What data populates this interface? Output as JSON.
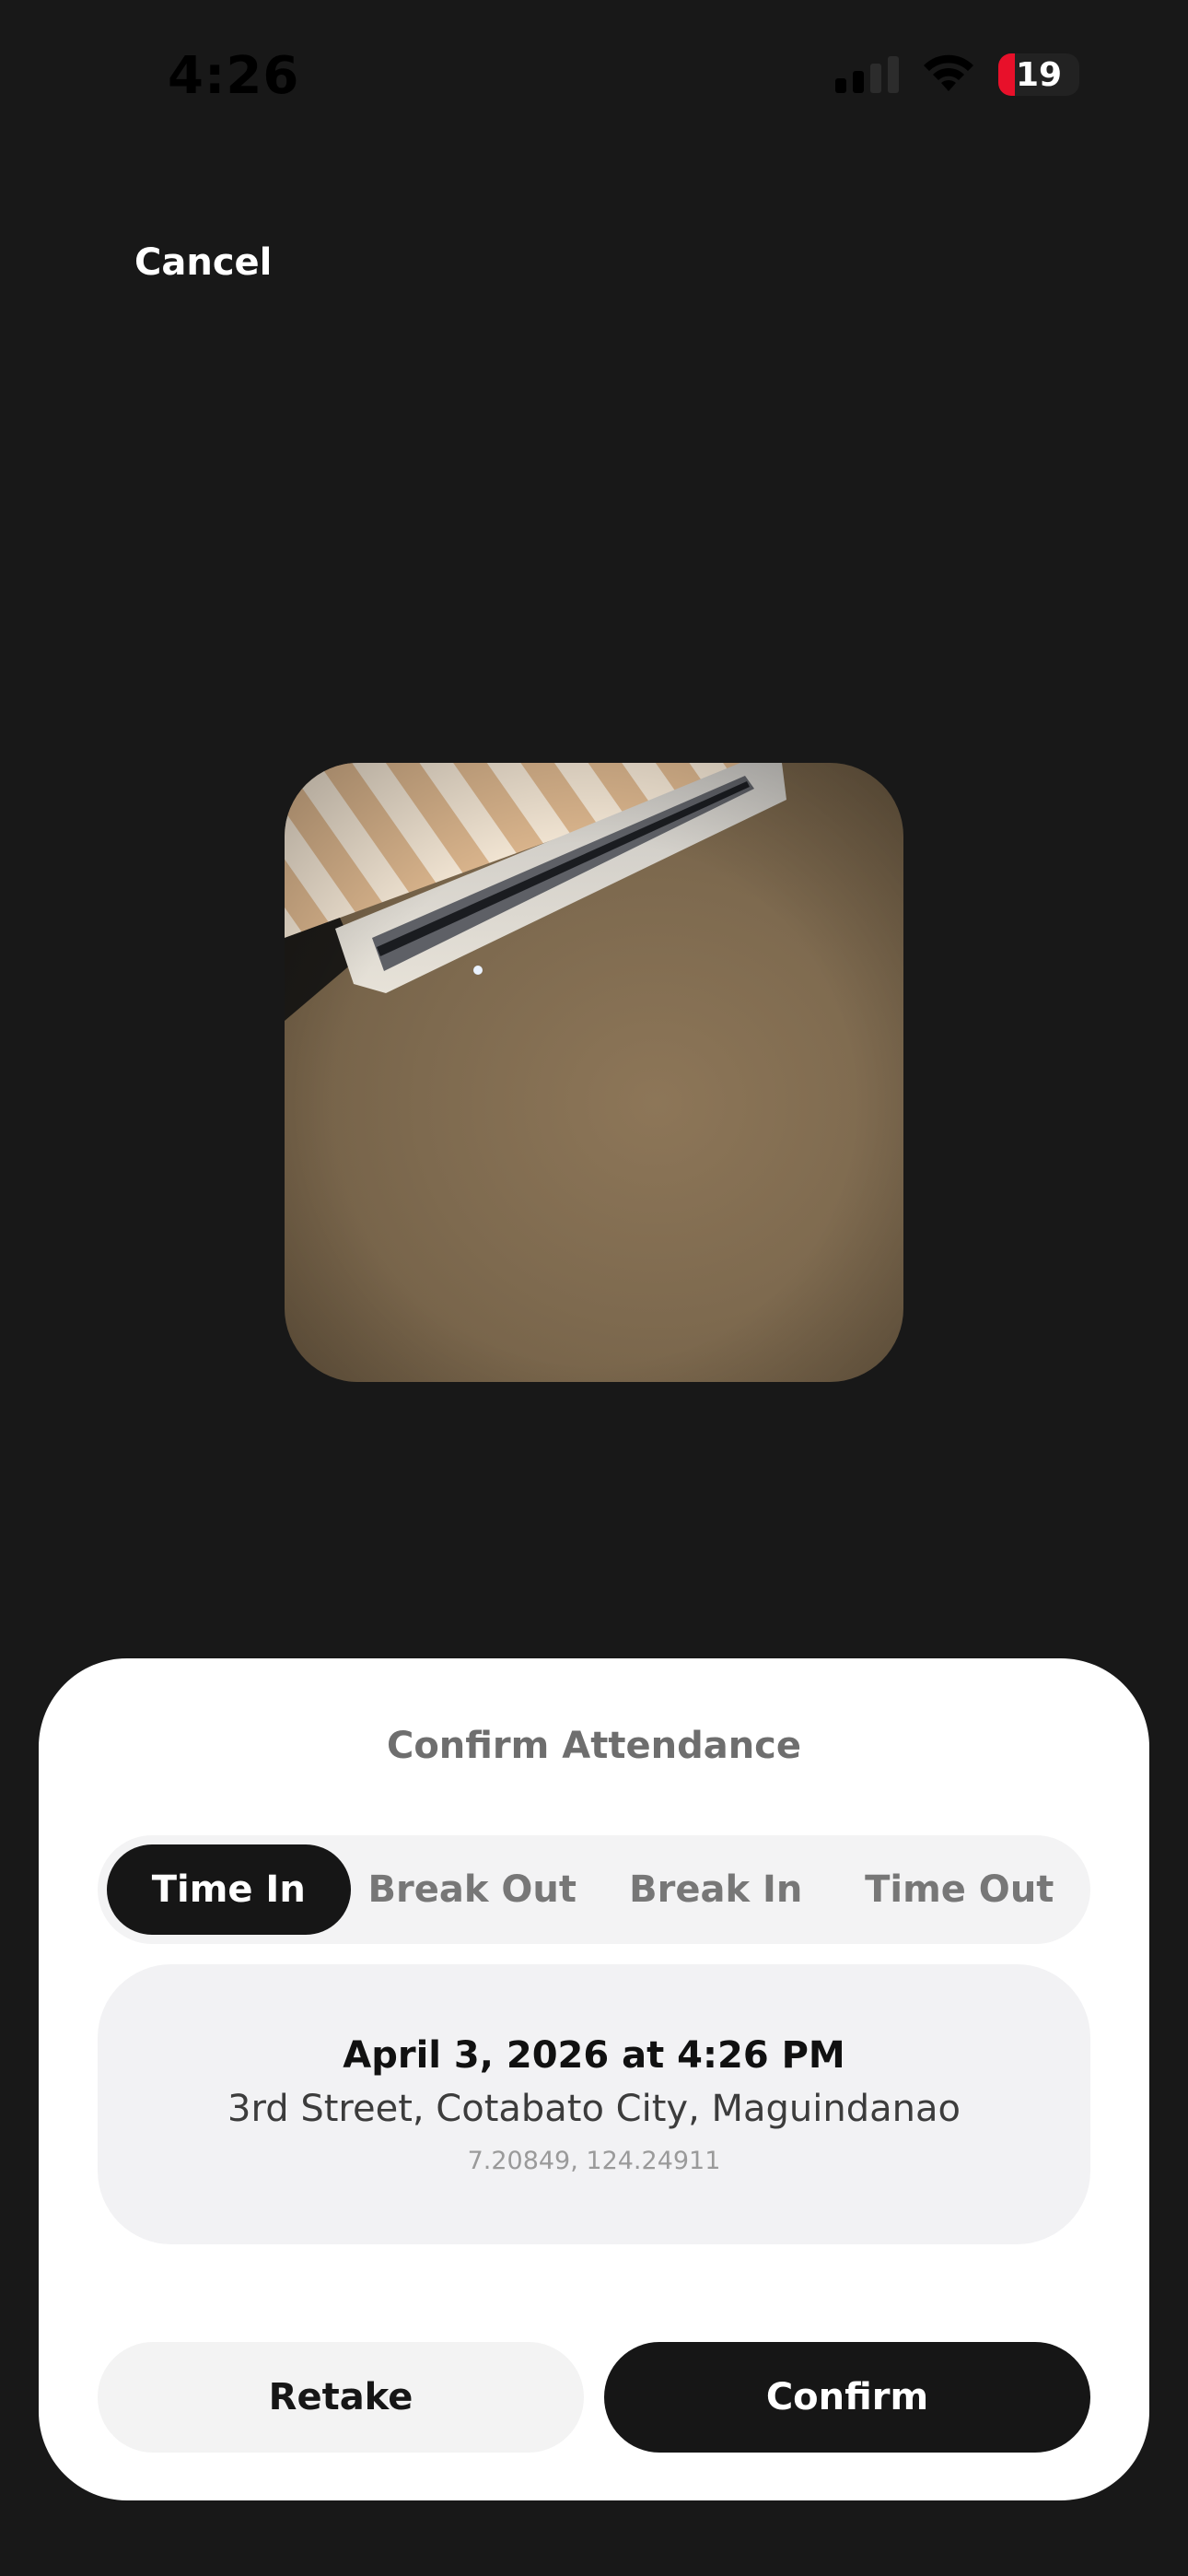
{
  "status_bar": {
    "time": "4:26",
    "battery_level": "19",
    "icons": [
      "cellular-signal-icon",
      "wifi-icon",
      "battery-icon"
    ]
  },
  "nav": {
    "cancel_label": "Cancel"
  },
  "photo": {
    "icon": "captured-photo"
  },
  "sheet": {
    "title": "Confirm Attendance",
    "segments": [
      {
        "label": "Time In",
        "active": true
      },
      {
        "label": "Break Out",
        "active": false
      },
      {
        "label": "Break In",
        "active": false
      },
      {
        "label": "Time Out",
        "active": false
      }
    ],
    "info": {
      "datetime": "April 3, 2026 at 4:26 PM",
      "address": "3rd Street, Cotabato City, Maguindanao",
      "coordinates": "7.20849, 124.24911"
    },
    "retake_label": "Retake",
    "confirm_label": "Confirm"
  },
  "colors": {
    "background": "#181818",
    "sheet": "#ffffff",
    "active_segment": "#161616",
    "battery_low": "#e8102a"
  }
}
